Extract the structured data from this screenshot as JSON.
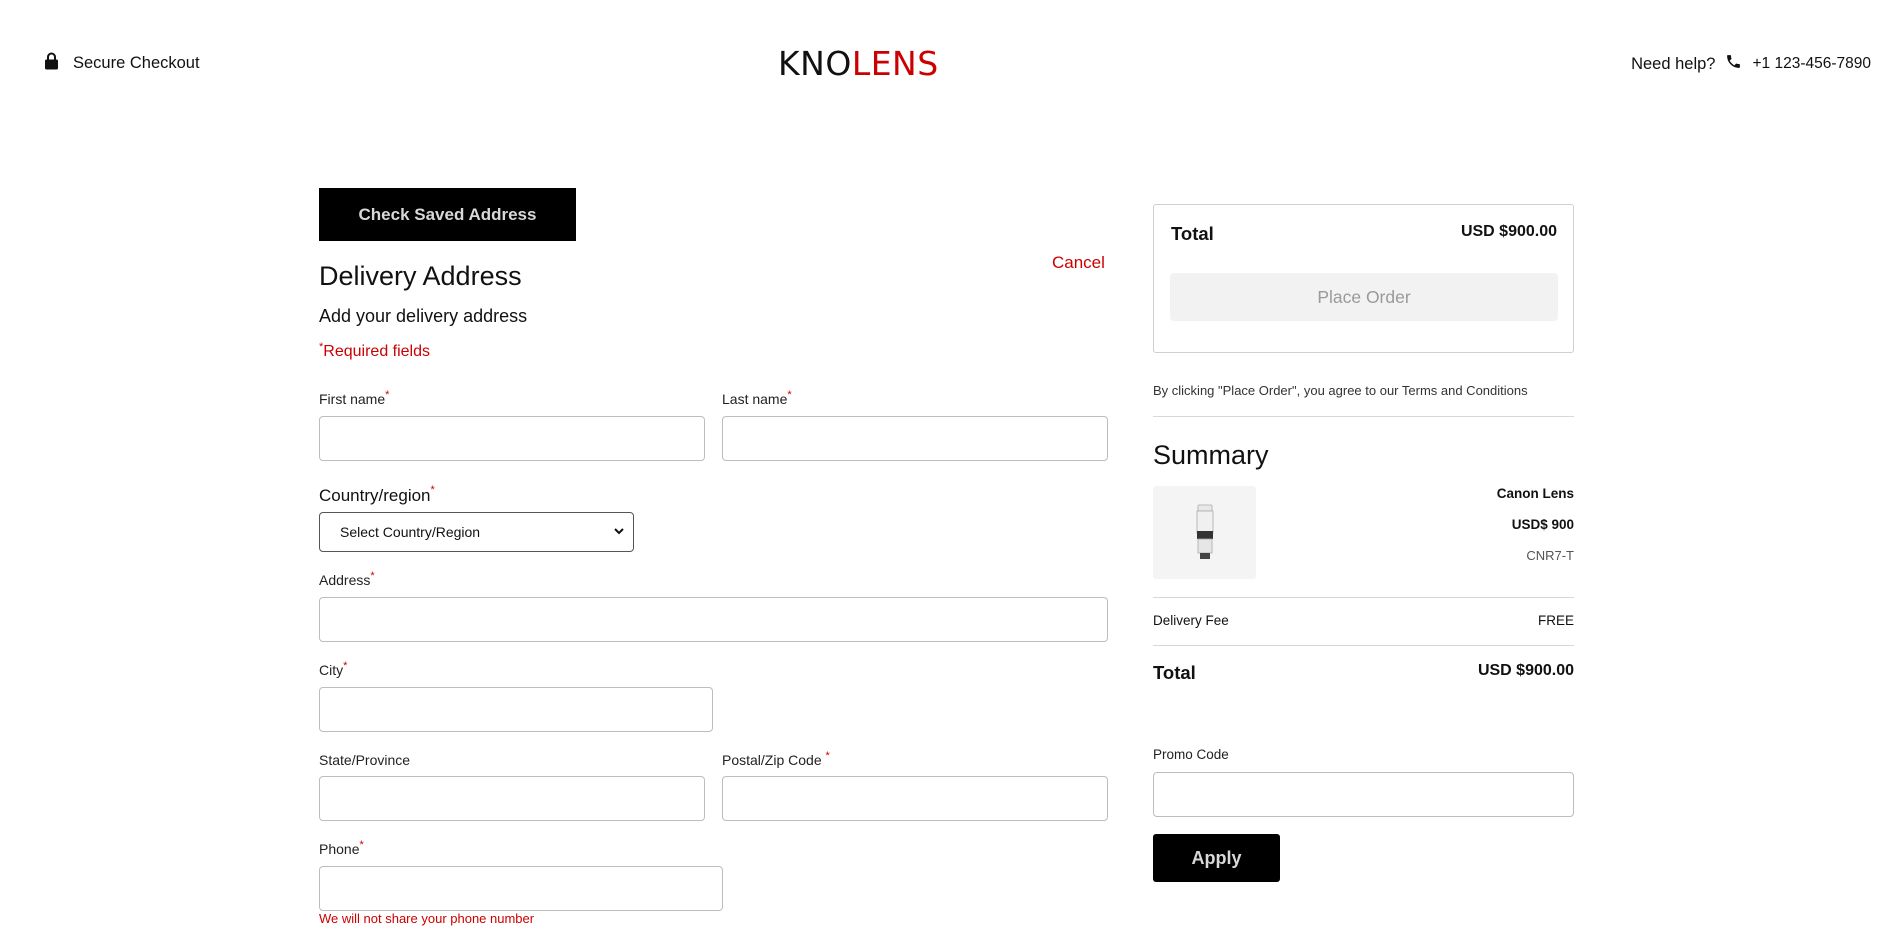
{
  "header": {
    "secure_label": "Secure Checkout",
    "logo_part1": "KNO",
    "logo_part2": "LENS",
    "help_label": "Need help?",
    "phone": "+1 123-456-7890"
  },
  "form": {
    "saved_address_button": "Check Saved Address",
    "cancel_label": "Cancel",
    "title": "Delivery Address",
    "subtitle": "Add your delivery address",
    "required_note": "Required fields",
    "required_mark": "*",
    "first_name_label": "First name",
    "last_name_label": "Last name",
    "country_label": "Country/region",
    "country_selected": "Select Country/Region",
    "address_label": "Address",
    "city_label": "City",
    "state_label": "State/Province",
    "postal_label": "Postal/Zip Code",
    "phone_label": "Phone",
    "phone_note": "We will not share your phone number"
  },
  "order": {
    "total_label": "Total",
    "total_value": "USD $900.00",
    "place_order_label": "Place Order",
    "agreement_text": "By clicking \"Place Order\", you agree to our Terms and Conditions"
  },
  "summary": {
    "title": "Summary",
    "product_name": "Canon Lens",
    "product_price": "USD$ 900",
    "product_sku": "CNR7-T",
    "delivery_fee_label": "Delivery Fee",
    "delivery_fee_value": "FREE",
    "total_label": "Total",
    "total_value": "USD $900.00"
  },
  "promo": {
    "label": "Promo Code",
    "value": "",
    "apply_label": "Apply"
  },
  "colors": {
    "accent_red": "#cc0000",
    "button_black": "#000000"
  }
}
